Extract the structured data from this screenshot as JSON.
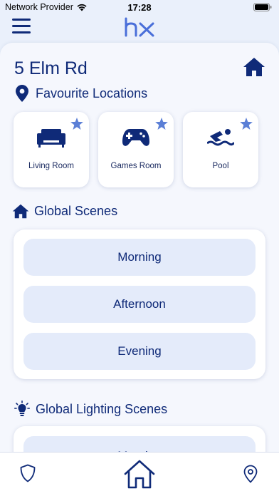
{
  "status": {
    "carrier": "Network Provider",
    "time": "17:28"
  },
  "header": {
    "logo_text": "hx"
  },
  "home": {
    "address": "5 Elm Rd"
  },
  "favourites": {
    "title": "Favourite Locations",
    "tiles": [
      {
        "label": "Living Room",
        "icon": "sofa-icon",
        "starred": true
      },
      {
        "label": "Games Room",
        "icon": "gamepad-icon",
        "starred": true
      },
      {
        "label": "Pool",
        "icon": "swimmer-icon",
        "starred": true
      }
    ]
  },
  "global_scenes": {
    "title": "Global Scenes",
    "items": [
      "Morning",
      "Afternoon",
      "Evening"
    ]
  },
  "lighting_scenes": {
    "title": "Global Lighting Scenes",
    "first_item": "Morning"
  },
  "tabbar": {
    "items": [
      "shield-icon",
      "home-icon",
      "location-pin-icon"
    ],
    "active": "home-icon"
  },
  "colors": {
    "accent": "#0f2a78",
    "star": "#5b7fd6",
    "background": "#eaf0fb",
    "button_bg": "#e4ebfa"
  }
}
